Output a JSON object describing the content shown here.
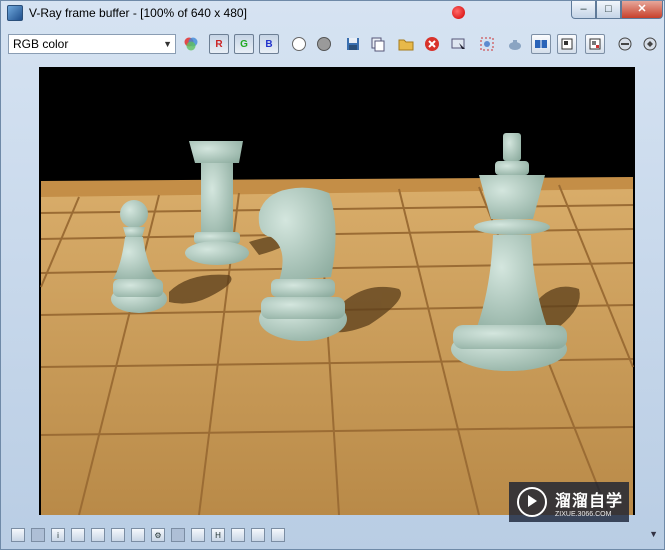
{
  "window": {
    "title": "V-Ray frame buffer - [100% of 640 x 480]",
    "buttons": {
      "minimize": "–",
      "maximize": "□",
      "close": "✕"
    }
  },
  "toolbar": {
    "channel": "RGB color",
    "red_label": "R",
    "green_label": "G",
    "blue_label": "B"
  },
  "statusbar": {
    "h_label": "H"
  },
  "watermark": {
    "brand": "溜溜自学",
    "url": "ZIXUE.3066.COM"
  },
  "colors": {
    "window_frame": "#b9cde4",
    "board": "#c99a55",
    "pieces": "#a9c4b8",
    "background": "#000000"
  }
}
